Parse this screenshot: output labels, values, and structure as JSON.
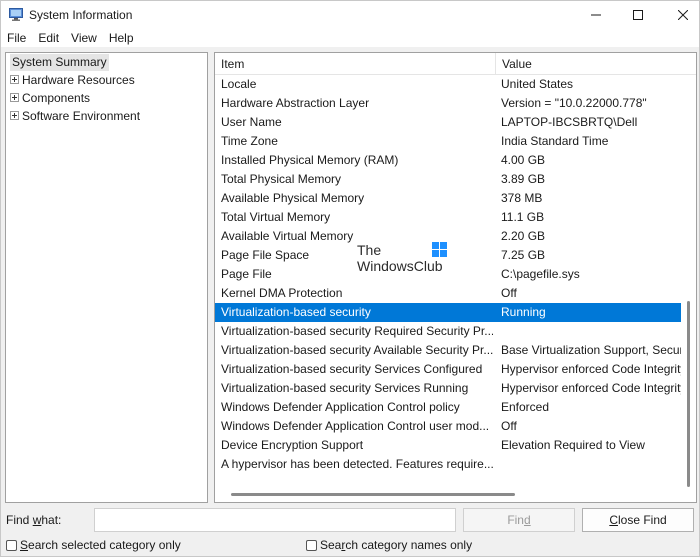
{
  "window": {
    "title": "System Information",
    "controls": {
      "minimize": "minimize-icon",
      "maximize": "maximize-icon",
      "close": "close-icon"
    }
  },
  "menu": [
    "File",
    "Edit",
    "View",
    "Help"
  ],
  "tree": {
    "root": "System Summary",
    "children": [
      "Hardware Resources",
      "Components",
      "Software Environment"
    ]
  },
  "list": {
    "headers": {
      "item": "Item",
      "value": "Value"
    },
    "rows": [
      {
        "item": "Locale",
        "value": "United States"
      },
      {
        "item": "Hardware Abstraction Layer",
        "value": "Version = \"10.0.22000.778\""
      },
      {
        "item": "User Name",
        "value": "LAPTOP-IBCSBRTQ\\Dell"
      },
      {
        "item": "Time Zone",
        "value": "India Standard Time"
      },
      {
        "item": "Installed Physical Memory (RAM)",
        "value": "4.00 GB"
      },
      {
        "item": "Total Physical Memory",
        "value": "3.89 GB"
      },
      {
        "item": "Available Physical Memory",
        "value": "378 MB"
      },
      {
        "item": "Total Virtual Memory",
        "value": "11.1 GB"
      },
      {
        "item": "Available Virtual Memory",
        "value": "2.20 GB"
      },
      {
        "item": "Page File Space",
        "value": "7.25 GB"
      },
      {
        "item": "Page File",
        "value": "C:\\pagefile.sys"
      },
      {
        "item": "Kernel DMA Protection",
        "value": "Off"
      },
      {
        "item": "Virtualization-based security",
        "value": "Running",
        "selected": true
      },
      {
        "item": "Virtualization-based security Required Security Pr...",
        "value": ""
      },
      {
        "item": "Virtualization-based security Available Security Pr...",
        "value": "Base Virtualization Support, Secure"
      },
      {
        "item": "Virtualization-based security Services Configured",
        "value": "Hypervisor enforced Code Integrity"
      },
      {
        "item": "Virtualization-based security Services Running",
        "value": "Hypervisor enforced Code Integrity"
      },
      {
        "item": "Windows Defender Application Control policy",
        "value": "Enforced"
      },
      {
        "item": "Windows Defender Application Control user mod...",
        "value": "Off"
      },
      {
        "item": "Device Encryption Support",
        "value": "Elevation Required to View"
      },
      {
        "item": "A hypervisor has been detected. Features require...",
        "value": ""
      }
    ]
  },
  "watermark": {
    "line1": "The",
    "line2": "WindowsClub"
  },
  "find": {
    "label_prefix": "Find ",
    "label_underlined": "w",
    "label_suffix": "hat:",
    "input_value": "",
    "find_button_prefix": "Fin",
    "find_button_underlined": "d",
    "close_button_underlined": "C",
    "close_button_suffix": "lose Find",
    "check1_underlined": "S",
    "check1_suffix": "earch selected category only",
    "check2_prefix": "Sea",
    "check2_underlined": "r",
    "check2_suffix": "ch category names only"
  },
  "colors": {
    "selection": "#0078d7",
    "accent_logo": "#1e90ff"
  }
}
